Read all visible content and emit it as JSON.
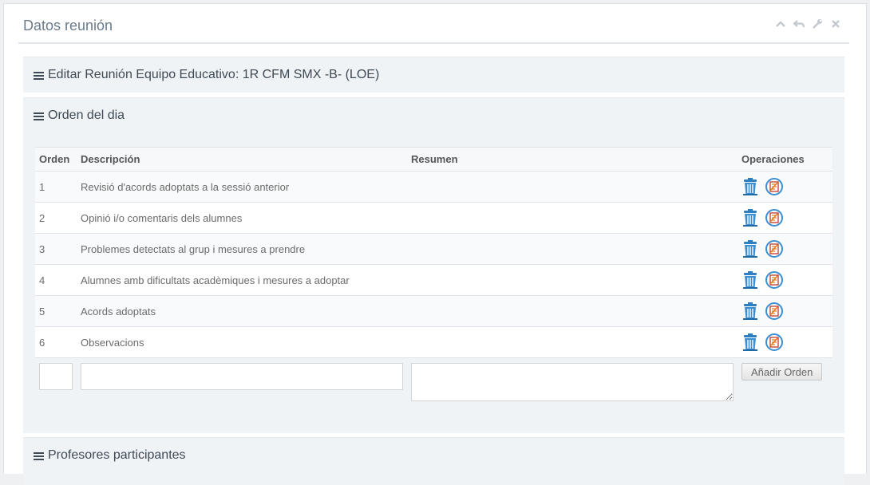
{
  "widget": {
    "title": "Datos reunión",
    "toolbar": [
      "chevron-up-icon",
      "undo-icon",
      "wrench-icon",
      "close-icon"
    ]
  },
  "sections": {
    "edit": {
      "title": "Editar Reunión Equipo Educativo: 1R CFM SMX -B- (LOE)"
    },
    "orden": {
      "title": "Orden del dia"
    },
    "profesores": {
      "title": "Profesores participantes"
    }
  },
  "table": {
    "headers": [
      "Orden",
      "Descripción",
      "Resumen",
      "Operaciones"
    ],
    "rows": [
      {
        "orden": "1",
        "descripcion": "Revisió d'acords adoptats a la sessió anterior",
        "resumen": ""
      },
      {
        "orden": "2",
        "descripcion": "Opinió i/o comentaris dels alumnes",
        "resumen": ""
      },
      {
        "orden": "3",
        "descripcion": "Problemes detectats al grup i mesures a prendre",
        "resumen": ""
      },
      {
        "orden": "4",
        "descripcion": "Alumnes amb dificultats acadèmiques i mesures a adoptar",
        "resumen": ""
      },
      {
        "orden": "5",
        "descripcion": "Acords adoptats",
        "resumen": ""
      },
      {
        "orden": "6",
        "descripcion": "Observacions",
        "resumen": ""
      }
    ],
    "operation_icons": [
      "trash-icon",
      "edit-document-icon"
    ]
  },
  "new_row": {
    "orden_value": "",
    "descripcion_value": "",
    "resumen_value": "",
    "add_button": "Añadir Orden"
  }
}
